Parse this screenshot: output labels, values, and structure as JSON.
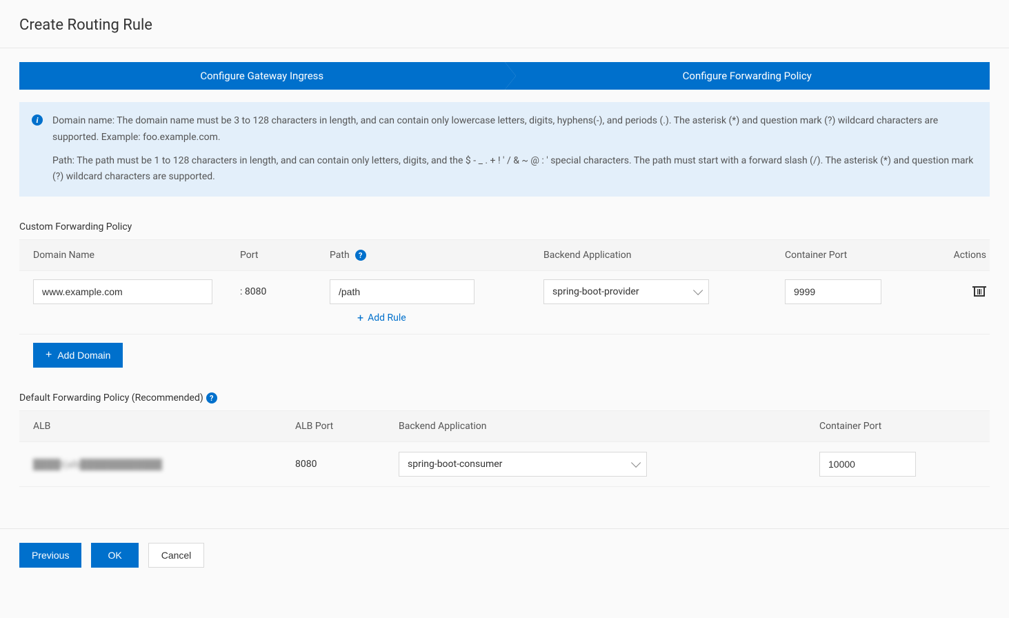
{
  "page": {
    "title": "Create Routing Rule"
  },
  "steps": {
    "step1": "Configure Gateway Ingress",
    "step2": "Configure Forwarding Policy"
  },
  "info": {
    "domain_text": "Domain name: The domain name must be 3 to 128 characters in length, and can contain only lowercase letters, digits, hyphens(-), and periods (.). The asterisk (*) and question mark (?) wildcard characters are supported. Example: foo.example.com.",
    "path_text": "Path: The path must be 1 to 128 characters in length, and can contain only letters, digits, and the $ - _ . + ! ' / & ~ @ : ' special characters. The path must start with a forward slash (/). The asterisk (*) and question mark (?) wildcard characters are supported."
  },
  "custom_policy": {
    "title": "Custom Forwarding Policy",
    "headers": {
      "domain": "Domain Name",
      "port": "Port",
      "path": "Path",
      "backend": "Backend Application",
      "container_port": "Container Port",
      "actions": "Actions"
    },
    "row": {
      "domain_value": "www.example.com",
      "port_value": ": 8080",
      "path_value": "/path",
      "backend_value": "spring-boot-provider",
      "container_port_value": "9999"
    },
    "add_rule_label": "Add Rule",
    "add_domain_label": "Add Domain"
  },
  "default_policy": {
    "title": "Default Forwarding Policy (Recommended)",
    "headers": {
      "alb": "ALB",
      "alb_port": "ALB Port",
      "backend": "Backend Application",
      "container_port": "Container Port"
    },
    "row": {
      "alb_value": "████t(alb████████████",
      "alb_port_value": "8080",
      "backend_value": "spring-boot-consumer",
      "container_port_value": "10000"
    }
  },
  "footer": {
    "previous": "Previous",
    "ok": "OK",
    "cancel": "Cancel"
  }
}
